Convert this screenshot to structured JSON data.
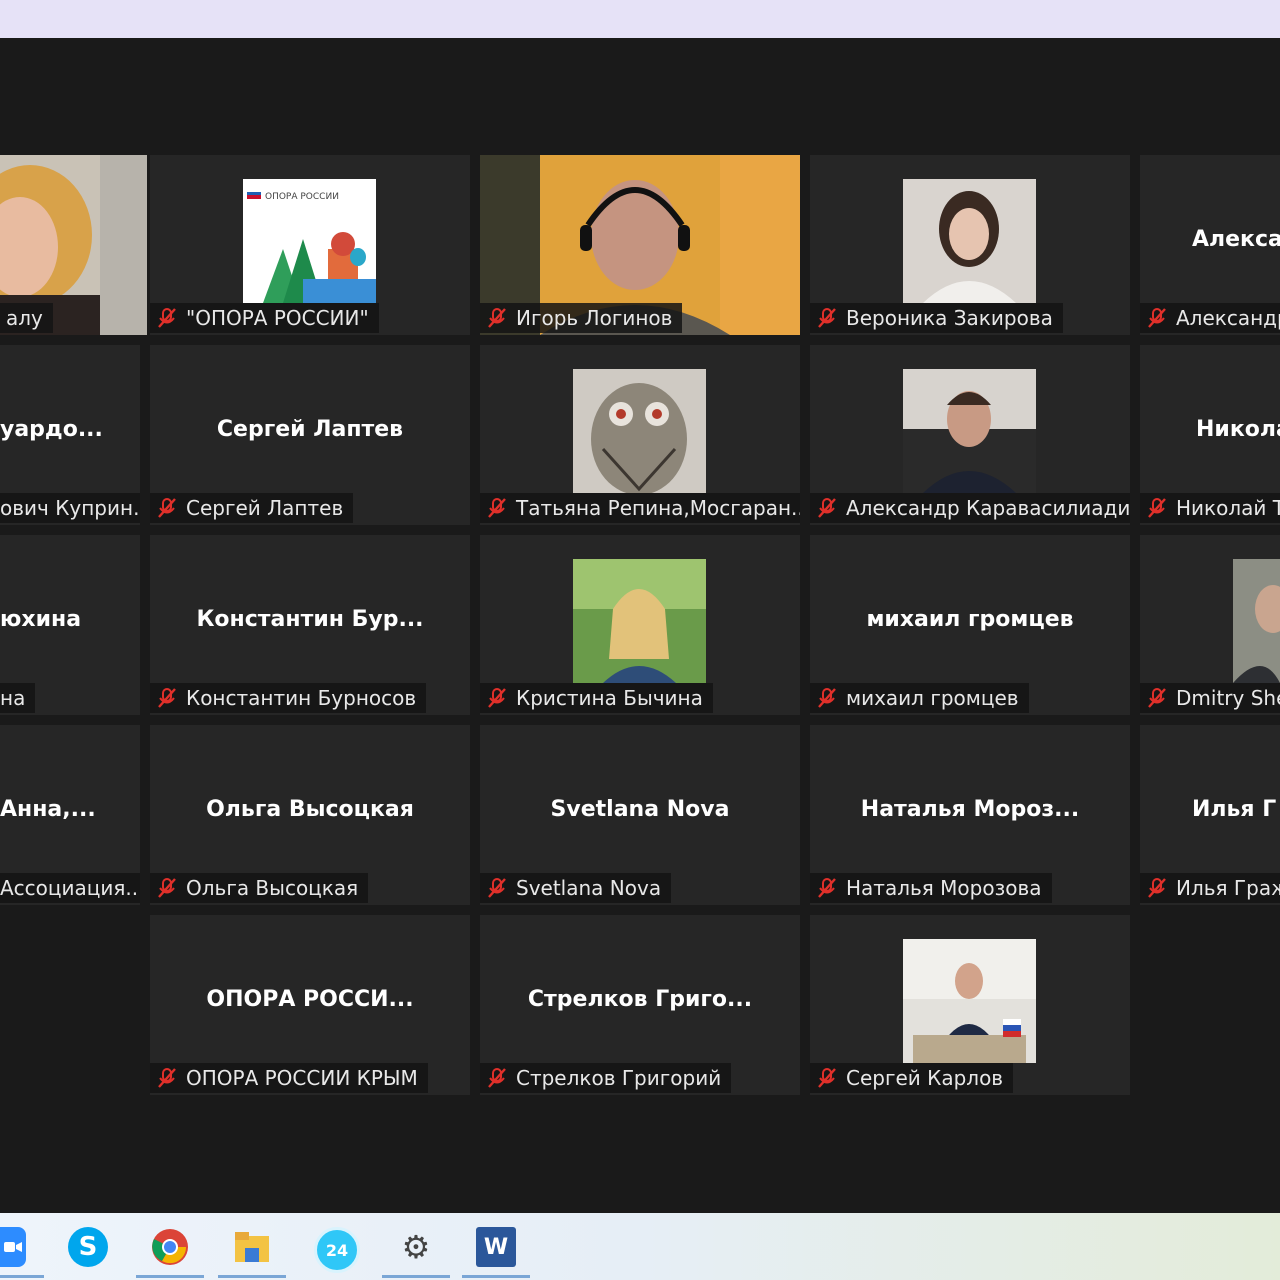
{
  "meeting": {
    "tiles": [
      {
        "id": "r1c0",
        "big": "",
        "label": "алу",
        "type": "video-woman"
      },
      {
        "id": "r1c1",
        "big": "",
        "label": "\"ОПОРА РОССИИ\"",
        "type": "logo-opora",
        "logo_text": "ОПОРА РОССИИ"
      },
      {
        "id": "r1c2",
        "big": "",
        "label": "Игорь Логинов",
        "type": "video-man"
      },
      {
        "id": "r1c3",
        "big": "",
        "label": "Вероника Закирова",
        "type": "photo-woman"
      },
      {
        "id": "r1c4",
        "big": "Алекса",
        "label": "Александр",
        "type": "name"
      },
      {
        "id": "r2c0",
        "big": "уардо...",
        "label": "ович Куприн...",
        "type": "name"
      },
      {
        "id": "r2c1",
        "big": "Сергей Лаптев",
        "label": "Сергей Лаптев",
        "type": "name"
      },
      {
        "id": "r2c2",
        "big": "",
        "label": "Татьяна Репина,Мосгаран...",
        "type": "photo-owl"
      },
      {
        "id": "r2c3",
        "big": "",
        "label": "Александр Каравасилиади",
        "type": "photo-man"
      },
      {
        "id": "r2c4",
        "big": "Никола",
        "label": "Николай Т",
        "type": "name"
      },
      {
        "id": "r3c0",
        "big": "юхина",
        "label": "на",
        "type": "name"
      },
      {
        "id": "r3c1",
        "big": "Константин  Бур...",
        "label": "Константин Бурносов",
        "type": "name"
      },
      {
        "id": "r3c2",
        "big": "",
        "label": "Кристина Бычина",
        "type": "photo-girl"
      },
      {
        "id": "r3c3",
        "big": "михаил громцев",
        "label": "михаил громцев",
        "type": "name"
      },
      {
        "id": "r3c4",
        "big": "",
        "label": "Dmitry She",
        "type": "photo-partial"
      },
      {
        "id": "r4c0",
        "big": "Анна,...",
        "label": "Ассоциация...",
        "type": "name"
      },
      {
        "id": "r4c1",
        "big": "Ольга Высоцкая",
        "label": "Ольга Высоцкая",
        "type": "name"
      },
      {
        "id": "r4c2",
        "big": "Svetlana Nova",
        "label": "Svetlana Nova",
        "type": "name"
      },
      {
        "id": "r4c3",
        "big": "Наталья  Мороз...",
        "label": "Наталья Морозова",
        "type": "name"
      },
      {
        "id": "r4c4",
        "big": "Илья  Г",
        "label": "Илья Граж",
        "type": "name"
      },
      {
        "id": "r5c1",
        "big": "ОПОРА  РОССИ...",
        "label": "ОПОРА РОССИИ КРЫМ",
        "type": "name"
      },
      {
        "id": "r5c2",
        "big": "Стрелков  Григо...",
        "label": "Стрелков Григорий",
        "type": "name"
      },
      {
        "id": "r5c3",
        "big": "",
        "label": "Сергей Карлов",
        "type": "photo-office"
      }
    ]
  },
  "taskbar": {
    "icons": [
      {
        "name": "zoom-icon",
        "glyph": ""
      },
      {
        "name": "skype-icon",
        "glyph": "S"
      },
      {
        "name": "chrome-icon",
        "glyph": ""
      },
      {
        "name": "file-explorer-icon",
        "glyph": ""
      },
      {
        "name": "bitrix24-icon",
        "glyph": "24"
      },
      {
        "name": "settings-gear-icon",
        "glyph": "⚙"
      },
      {
        "name": "word-icon",
        "glyph": "W"
      }
    ]
  }
}
